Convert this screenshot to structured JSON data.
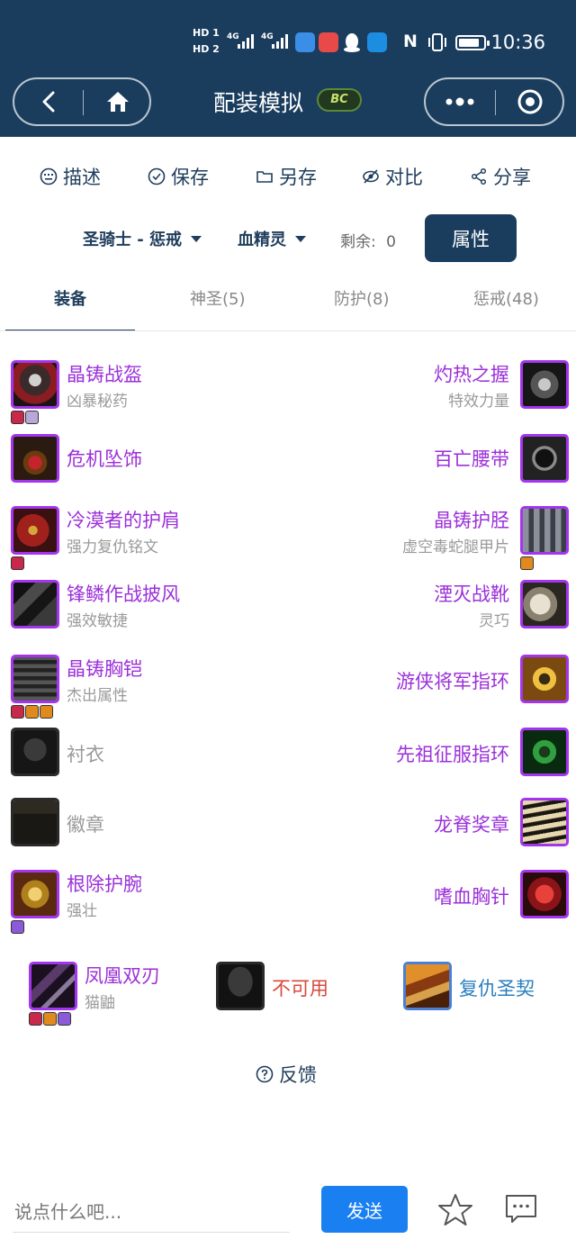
{
  "status_bar": {
    "time": "10:36",
    "sim1": "HD 1",
    "sim2": "HD 2",
    "net1": "4G",
    "net2": "4G",
    "app_icons": [
      "browser-icon",
      "huawei-app-icon",
      "qq-icon",
      "bulb-app-icon"
    ],
    "nfc": "N",
    "battery_level_fraction": 0.85
  },
  "nav": {
    "title": "配装模拟",
    "logo_text": "BC",
    "back_icon": "chevron-left-icon",
    "home_icon": "home-icon",
    "more_icon": "more-dots-icon",
    "close_icon": "target-circle-icon"
  },
  "actions": [
    {
      "label": "描述",
      "icon": "keyboard-icon"
    },
    {
      "label": "保存",
      "icon": "check-circle-icon"
    },
    {
      "label": "另存",
      "icon": "folder-icon"
    },
    {
      "label": "对比",
      "icon": "compare-icon"
    },
    {
      "label": "分享",
      "icon": "share-icon"
    }
  ],
  "class_row": {
    "class_spec": "圣骑士 - 惩戒",
    "race": "血精灵",
    "remaining_label": "剩余:",
    "remaining_value": "0",
    "attr_button": "属性"
  },
  "tabs": [
    {
      "label": "装备",
      "active": true
    },
    {
      "label": "神圣(5)",
      "active": false
    },
    {
      "label": "防护(8)",
      "active": false
    },
    {
      "label": "惩戒(48)",
      "active": false
    }
  ],
  "gear_left": [
    {
      "name": "晶铸战盔",
      "enchant": "凶暴秘药",
      "quality": "epic",
      "gems": [
        "#c8284a",
        "#b8a8d8"
      ]
    },
    {
      "name": "危机坠饰",
      "enchant": "",
      "quality": "epic",
      "gems": []
    },
    {
      "name": "冷漠者的护肩",
      "enchant": "强力复仇铭文",
      "quality": "epic",
      "gems": [
        "#c8284a"
      ]
    },
    {
      "name": "锋鳞作战披风",
      "enchant": "强效敏捷",
      "quality": "epic",
      "gems": []
    },
    {
      "name": "晶铸胸铠",
      "enchant": "杰出属性",
      "quality": "epic",
      "gems": [
        "#c8284a",
        "#e08a1e",
        "#e08a1e"
      ]
    },
    {
      "name": "衬衣",
      "enchant": "",
      "quality": "empty",
      "gems": []
    },
    {
      "name": "徽章",
      "enchant": "",
      "quality": "empty",
      "gems": []
    },
    {
      "name": "根除护腕",
      "enchant": "强壮",
      "quality": "epic",
      "gems": [
        "#8a5ad8"
      ]
    }
  ],
  "gear_right": [
    {
      "name": "灼热之握",
      "enchant": "特效力量",
      "quality": "epic",
      "gems": []
    },
    {
      "name": "百亡腰带",
      "enchant": "",
      "quality": "epic",
      "gems": []
    },
    {
      "name": "晶铸护胫",
      "enchant": "虚空毒蛇腿甲片",
      "quality": "epic",
      "gems": [
        "#e08a1e"
      ]
    },
    {
      "name": "湮灭战靴",
      "enchant": "灵巧",
      "quality": "epic",
      "gems": []
    },
    {
      "name": "游侠将军指环",
      "enchant": "",
      "quality": "epic",
      "gems": []
    },
    {
      "name": "先祖征服指环",
      "enchant": "",
      "quality": "epic",
      "gems": []
    },
    {
      "name": "龙脊奖章",
      "enchant": "",
      "quality": "epic",
      "gems": []
    },
    {
      "name": "嗜血胸针",
      "enchant": "",
      "quality": "epic",
      "gems": []
    }
  ],
  "weapons": [
    {
      "name": "凤凰双刃",
      "enchant": "猫鼬",
      "quality": "epic",
      "gems": [
        "#c8284a",
        "#e08a1e",
        "#8a5ad8"
      ]
    },
    {
      "name": "不可用",
      "enchant": "",
      "quality": "unavailable",
      "gems": []
    },
    {
      "name": "复仇圣契",
      "enchant": "",
      "quality": "rare",
      "gems": []
    }
  ],
  "feedback": {
    "label": "反馈",
    "icon": "question-circle-icon"
  },
  "bottom": {
    "input_placeholder": "说点什么吧...",
    "send_label": "发送",
    "star_icon": "star-icon",
    "comment_icon": "comment-icon"
  },
  "colors": {
    "header_bg": "#1a3d5e",
    "epic": "#9b30d9",
    "rare": "#2a7fbf",
    "unavailable": "#d8483b",
    "send": "#1a7ff0"
  }
}
